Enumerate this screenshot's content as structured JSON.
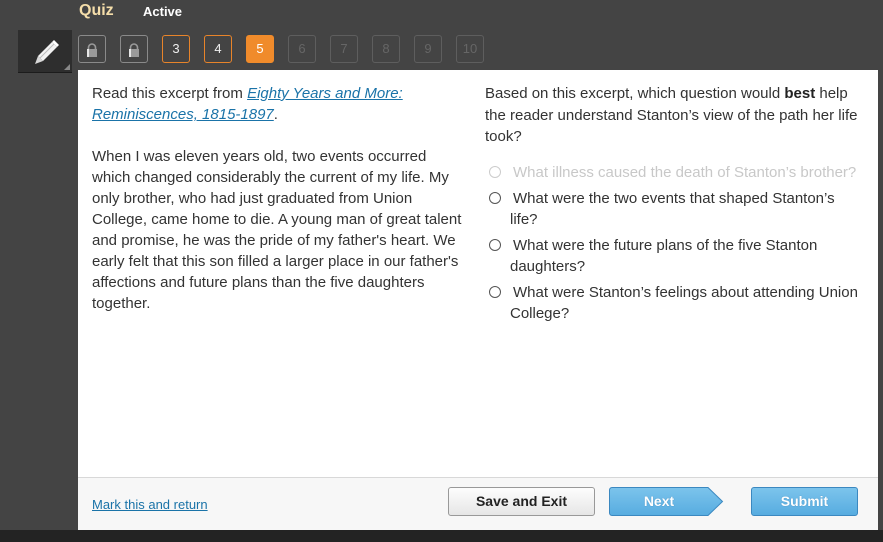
{
  "header": {
    "title": "Quiz",
    "status": "Active"
  },
  "toolbar": {
    "tool_icon": "pencil-icon"
  },
  "question_nav": [
    {
      "label": "",
      "state": "locked",
      "icon": "lock-icon"
    },
    {
      "label": "",
      "state": "locked",
      "icon": "lock-icon"
    },
    {
      "label": "3",
      "state": "answered"
    },
    {
      "label": "4",
      "state": "answered"
    },
    {
      "label": "5",
      "state": "current"
    },
    {
      "label": "6",
      "state": "future"
    },
    {
      "label": "7",
      "state": "future"
    },
    {
      "label": "8",
      "state": "future"
    },
    {
      "label": "9",
      "state": "future"
    },
    {
      "label": "10",
      "state": "future"
    }
  ],
  "passage": {
    "intro_prefix": "Read this excerpt from ",
    "source_title": "Eighty Years and More: Reminiscences, 1815-1897",
    "intro_suffix": ".",
    "excerpt": "When I was eleven years old, two events occurred which changed considerably the current of my life. My only brother, who had just graduated from Union College, came home to die. A young man of great talent and promise, he was the pride of my father's heart. We early felt that this son filled a larger place in our father's affections and future plans than the five daughters together."
  },
  "question": {
    "prompt_before": "Based on this excerpt, which question would ",
    "prompt_bold": "best",
    "prompt_after": " help the reader understand Stanton’s view of the path her life took?",
    "options": [
      {
        "text": "What illness caused the death of Stanton’s brother?",
        "disabled": true
      },
      {
        "text": "What were the two events that shaped Stanton’s life?",
        "disabled": false
      },
      {
        "text": "What were the future plans of the five Stanton daughters?",
        "disabled": false
      },
      {
        "text": "What were Stanton’s feelings about attending Union College?",
        "disabled": false
      }
    ]
  },
  "footer": {
    "mark_link": "Mark this and return",
    "save_label": "Save and Exit",
    "next_label": "Next",
    "submit_label": "Submit"
  },
  "colors": {
    "accent_orange": "#f08b2b",
    "link_blue": "#1a73a8",
    "button_blue": "#5fb2e3",
    "title_gold": "#f5deaa"
  }
}
